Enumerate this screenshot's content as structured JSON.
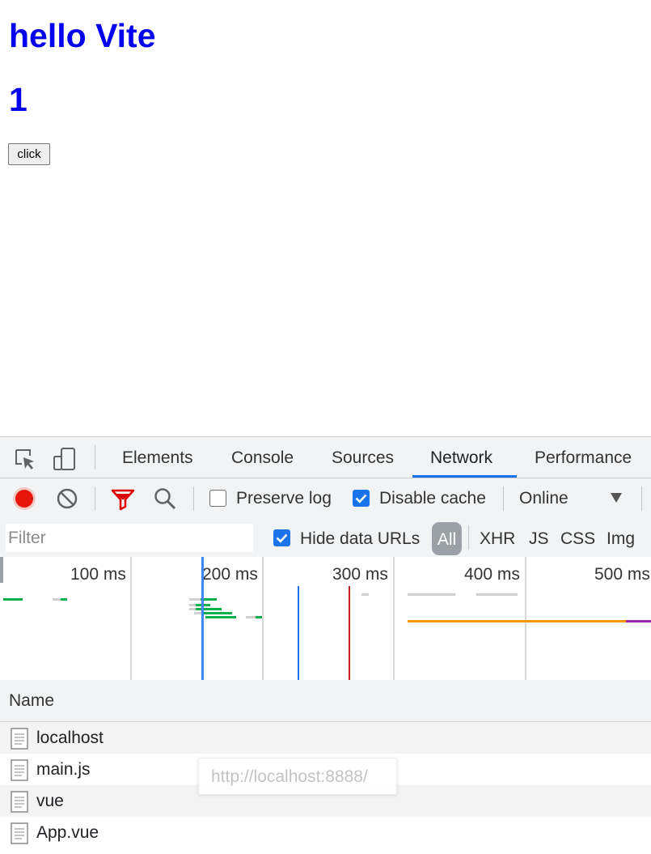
{
  "page": {
    "title": "hello Vite",
    "count": "1",
    "button_label": "click"
  },
  "devtools": {
    "tabs": [
      {
        "label": "Elements"
      },
      {
        "label": "Console"
      },
      {
        "label": "Sources"
      },
      {
        "label": "Network",
        "active": true
      },
      {
        "label": "Performance"
      }
    ],
    "toolbar": {
      "record_icon": "record-icon",
      "clear_icon": "clear-icon",
      "filter_icon": "filter-icon",
      "search_icon": "search-icon",
      "preserve_log": {
        "label": "Preserve log",
        "checked": false
      },
      "disable_cache": {
        "label": "Disable cache",
        "checked": true
      },
      "throttling": "Online"
    },
    "filter": {
      "placeholder": "Filter",
      "hide_data_urls": {
        "label": "Hide data URLs",
        "checked": true
      },
      "types": [
        "All",
        "XHR",
        "JS",
        "CSS",
        "Img"
      ],
      "active_type": "All"
    },
    "overview": {
      "ticks": [
        "100 ms",
        "200 ms",
        "300 ms",
        "400 ms",
        "500 ms"
      ]
    },
    "table": {
      "header": "Name",
      "rows": [
        "localhost",
        "main.js",
        "vue",
        "App.vue"
      ]
    },
    "tooltip": "http://localhost:8888/"
  },
  "colors": {
    "heading": "#0000ee",
    "record": "#e8150d",
    "active_tab": "#1a73e8",
    "dom_content_loaded": "#1a73e8",
    "load_event": "#c5221f",
    "waiting": "#f29900",
    "download": "#9c27b0",
    "green": "#0db14b"
  }
}
